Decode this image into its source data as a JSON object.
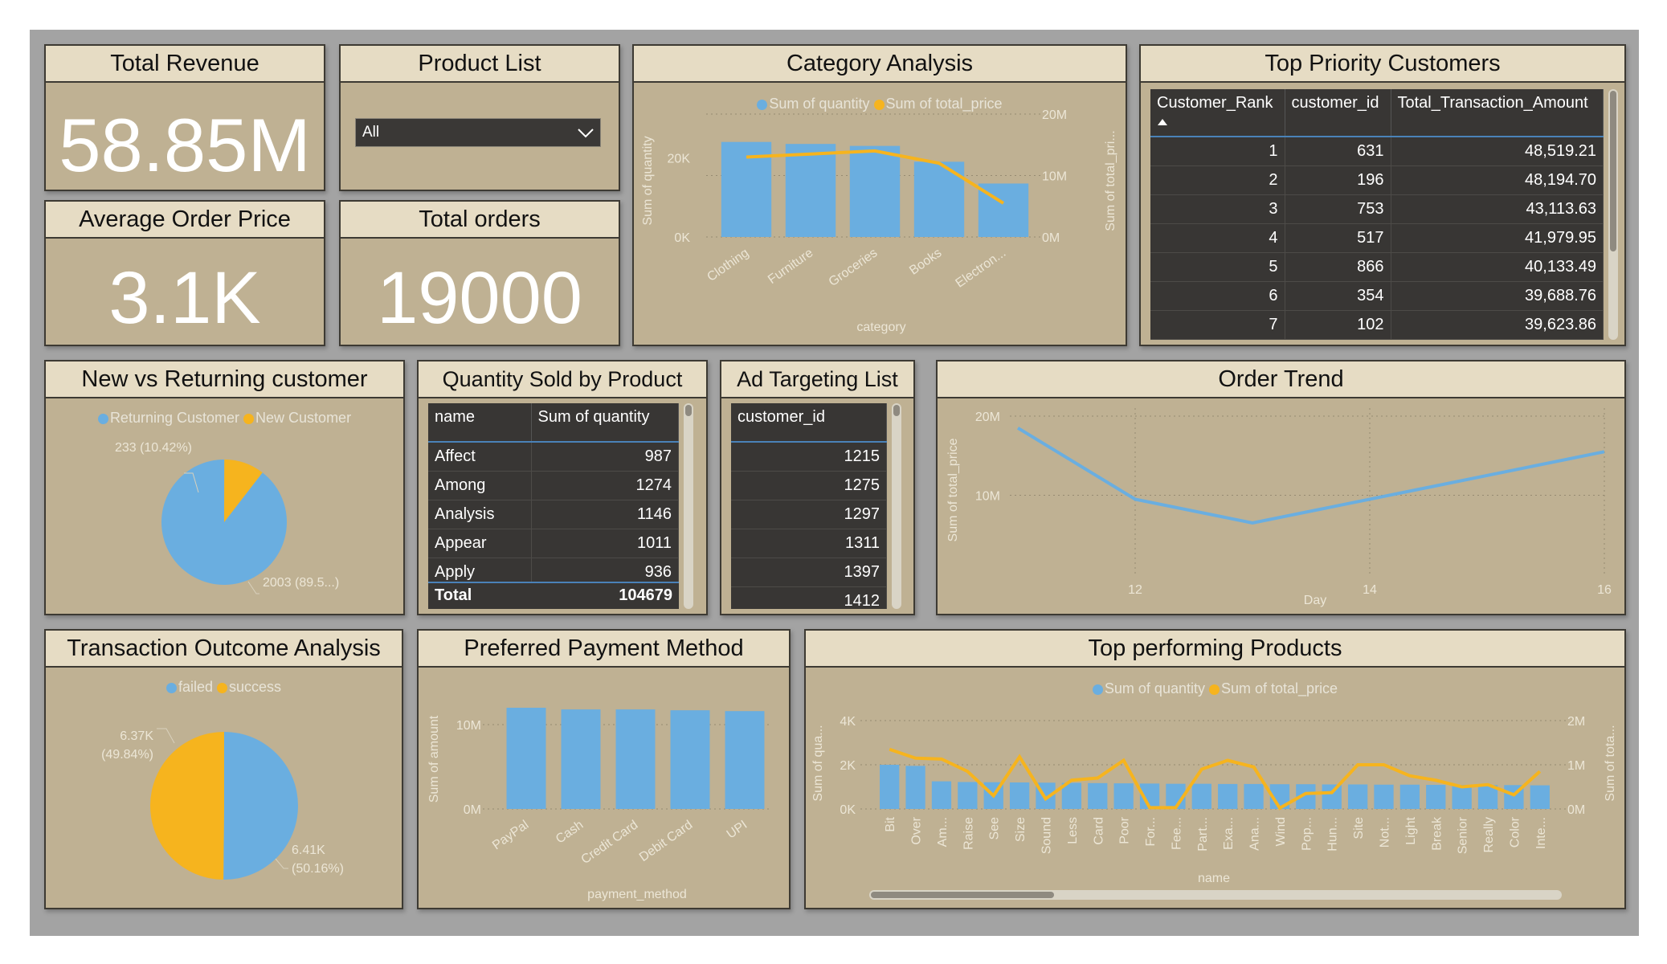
{
  "kpis": {
    "total_revenue": {
      "title": "Total Revenue",
      "value": "58.85M"
    },
    "avg_order_price": {
      "title": "Average Order Price",
      "value": "3.1K"
    },
    "total_orders": {
      "title": "Total orders",
      "value": "19000"
    }
  },
  "product_list": {
    "title": "Product List",
    "selected": "All"
  },
  "category_analysis": {
    "title": "Category Analysis",
    "legend": [
      "Sum of quantity",
      "Sum of total_price"
    ],
    "y_left_label": "Sum of quantity",
    "y_right_label": "Sum of total_pri...",
    "x_label": "category",
    "left_ticks": [
      "0K",
      "20K"
    ],
    "right_ticks": [
      "0M",
      "10M",
      "20M"
    ],
    "category_labels": [
      "Clothing",
      "Furniture",
      "Groceries",
      "Books",
      "Electron..."
    ]
  },
  "top_customers": {
    "title": "Top Priority Customers",
    "columns": [
      "Customer_Rank",
      "customer_id",
      "Total_Transaction_Amount"
    ],
    "rows": [
      [
        "1",
        "631",
        "48,519.21"
      ],
      [
        "2",
        "196",
        "48,194.70"
      ],
      [
        "3",
        "753",
        "43,113.63"
      ],
      [
        "4",
        "517",
        "41,979.95"
      ],
      [
        "5",
        "866",
        "40,133.49"
      ],
      [
        "6",
        "354",
        "39,688.76"
      ],
      [
        "7",
        "102",
        "39,623.86"
      ]
    ]
  },
  "new_vs_returning": {
    "title": "New vs Returning customer",
    "legend": [
      "Returning Customer",
      "New Customer"
    ],
    "label_new": "233 (10.42%)",
    "label_returning": "2003 (89.5...)"
  },
  "quantity_by_product": {
    "title": "Quantity Sold by Product",
    "columns": [
      "name",
      "Sum of quantity"
    ],
    "rows": [
      [
        "Affect",
        "987"
      ],
      [
        "Among",
        "1274"
      ],
      [
        "Analysis",
        "1146"
      ],
      [
        "Appear",
        "1011"
      ],
      [
        "Apply",
        "936"
      ]
    ],
    "total_label": "Total",
    "total_value": "104679"
  },
  "ad_targeting": {
    "title": "Ad Targeting List",
    "column": "customer_id",
    "rows": [
      "1215",
      "1275",
      "1297",
      "1311",
      "1397",
      "1412"
    ]
  },
  "order_trend": {
    "title": "Order Trend",
    "y_label": "Sum of total_price",
    "x_label": "Day",
    "y_ticks": [
      "10M",
      "20M"
    ],
    "x_ticks": [
      "12",
      "14",
      "16"
    ]
  },
  "transaction_outcome": {
    "title": "Transaction Outcome Analysis",
    "legend": [
      "failed",
      "success"
    ],
    "label_success_1": "6.37K",
    "label_success_2": "(49.84%)",
    "label_failed_1": "6.41K",
    "label_failed_2": "(50.16%)"
  },
  "payment_method": {
    "title": "Preferred Payment Method",
    "y_label": "Sum of amount",
    "x_label": "payment_method",
    "y_ticks": [
      "0M",
      "10M"
    ],
    "category_labels": [
      "PayPal",
      "Cash",
      "Credit Card",
      "Debit Card",
      "UPI"
    ]
  },
  "top_products": {
    "title": "Top performing Products",
    "legend": [
      "Sum of quantity",
      "Sum of total_price"
    ],
    "y_left_label": "Sum of qua...",
    "y_right_label": "Sum of tota...",
    "x_label": "name",
    "left_ticks": [
      "0K",
      "2K",
      "4K"
    ],
    "right_ticks": [
      "0M",
      "1M",
      "2M"
    ],
    "category_labels": [
      "Bit",
      "Over",
      "Am...",
      "Raise",
      "See",
      "Size",
      "Sound",
      "Less",
      "Card",
      "Poor",
      "For...",
      "Fee...",
      "Part...",
      "Exa...",
      "Ana...",
      "Wind",
      "Pop...",
      "Hun...",
      "Site",
      "Not...",
      "Light",
      "Break",
      "Senior",
      "Really",
      "Color",
      "Inte..."
    ]
  },
  "chart_data": [
    {
      "type": "bar",
      "title": "Category Analysis",
      "categories": [
        "Clothing",
        "Furniture",
        "Groceries",
        "Books",
        "Electron..."
      ],
      "series": [
        {
          "name": "Sum of quantity",
          "axis": "left",
          "values": [
            24000,
            23500,
            23000,
            19000,
            13500
          ]
        },
        {
          "name": "Sum of total_price",
          "axis": "right",
          "type": "line",
          "values": [
            13000000,
            13500000,
            14000000,
            12000000,
            5500000
          ]
        }
      ],
      "xlabel": "category",
      "ylabel": "Sum of quantity",
      "y2label": "Sum of total_pri...",
      "ylim": [
        0,
        28000
      ],
      "y2lim": [
        0,
        20000000
      ]
    },
    {
      "type": "pie",
      "title": "New vs Returning customer",
      "categories": [
        "Returning Customer",
        "New Customer"
      ],
      "values": [
        2003,
        233
      ],
      "colors": [
        "#6aaee0",
        "#f6b41e"
      ]
    },
    {
      "type": "line",
      "title": "Order Trend",
      "x": [
        11,
        12,
        13,
        14,
        16
      ],
      "values": [
        18500000,
        9500000,
        6500000,
        9500000,
        15500000
      ],
      "xlabel": "Day",
      "ylabel": "Sum of total_price",
      "xlim": [
        11,
        16
      ],
      "ylim": [
        0,
        20000000
      ]
    },
    {
      "type": "pie",
      "title": "Transaction Outcome Analysis",
      "categories": [
        "failed",
        "success"
      ],
      "values": [
        6410,
        6370
      ],
      "colors": [
        "#6aaee0",
        "#f6b41e"
      ]
    },
    {
      "type": "bar",
      "title": "Preferred Payment Method",
      "categories": [
        "PayPal",
        "Cash",
        "Credit Card",
        "Debit Card",
        "UPI"
      ],
      "values": [
        12000000,
        11800000,
        11800000,
        11700000,
        11600000
      ],
      "xlabel": "payment_method",
      "ylabel": "Sum of amount",
      "ylim": [
        0,
        14000000
      ]
    },
    {
      "type": "bar",
      "title": "Top performing Products",
      "categories": [
        "Bit",
        "Over",
        "Am...",
        "Raise",
        "See",
        "Size",
        "Sound",
        "Less",
        "Card",
        "Poor",
        "For...",
        "Fee...",
        "Part...",
        "Exa...",
        "Ana...",
        "Wind",
        "Pop...",
        "Hun...",
        "Site",
        "Not...",
        "Light",
        "Break",
        "Senior",
        "Really",
        "Color",
        "Inte..."
      ],
      "series": [
        {
          "name": "Sum of quantity",
          "axis": "left",
          "values": [
            2000,
            1950,
            1250,
            1220,
            1210,
            1200,
            1190,
            1180,
            1170,
            1160,
            1150,
            1140,
            1140,
            1130,
            1130,
            1120,
            1120,
            1110,
            1110,
            1100,
            1100,
            1090,
            1090,
            1080,
            1080,
            1070
          ]
        },
        {
          "name": "Sum of total_price",
          "axis": "right",
          "type": "line",
          "values": [
            1350000,
            1150000,
            1130000,
            850000,
            300000,
            1180000,
            230000,
            650000,
            700000,
            1100000,
            30000,
            30000,
            900000,
            1100000,
            950000,
            20000,
            350000,
            370000,
            1000000,
            1000000,
            750000,
            650000,
            500000,
            550000,
            320000,
            850000
          ]
        }
      ],
      "xlabel": "name",
      "ylabel": "Sum of qua...",
      "y2label": "Sum of tota...",
      "ylim": [
        0,
        4000
      ],
      "y2lim": [
        0,
        2000000
      ]
    }
  ]
}
